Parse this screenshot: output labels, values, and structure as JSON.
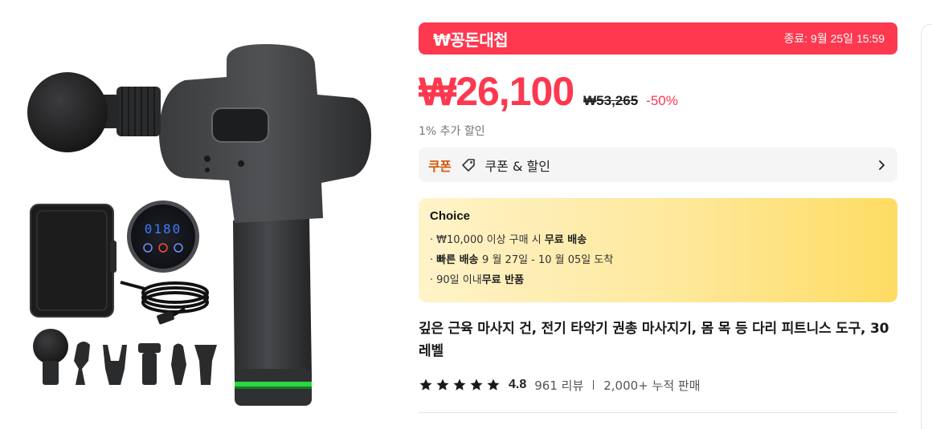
{
  "colors": {
    "brand_red": "#fd384f",
    "coupon_orange": "#d4570a",
    "choice_gradient_start": "#fff3c9",
    "choice_gradient_end": "#fedc63",
    "coupon_bg": "#f5f5f5"
  },
  "product_image": {
    "display_digits": "0180"
  },
  "deal_banner": {
    "title": "₩꽁돈대첩",
    "end_time": "종료: 9월 25일 15:59"
  },
  "price": {
    "current": "₩26,100",
    "original": "₩53,265",
    "discount": "-50%",
    "extra_discount": "1% 추가 할인"
  },
  "coupon": {
    "badge": "쿠폰",
    "label": "쿠폰 & 할인",
    "icons": [
      "tag-icon",
      "chevron-right-icon"
    ]
  },
  "choice": {
    "title": "Choice",
    "lines": [
      {
        "bullet": "·",
        "normal": "₩10,000 이상 구매 시 ",
        "bold": "무료 배송"
      },
      {
        "bullet": "·",
        "bold_pre": "빠른 배송 ",
        "normal": "9 월 27일 - 10 월 05일 도착"
      },
      {
        "bullet": "·",
        "normal": "90일 이내",
        "bold": "무료 반품"
      }
    ]
  },
  "product": {
    "title": "깊은 근육 마사지 건, 전기 타악기 권총 마사지기, 몸 목 등 다리 피트니스 도구, 30 레벨"
  },
  "rating": {
    "score": "4.8",
    "stars": 5,
    "reviews": "961 리뷰",
    "sold": "2,000+ 누적 판매"
  }
}
